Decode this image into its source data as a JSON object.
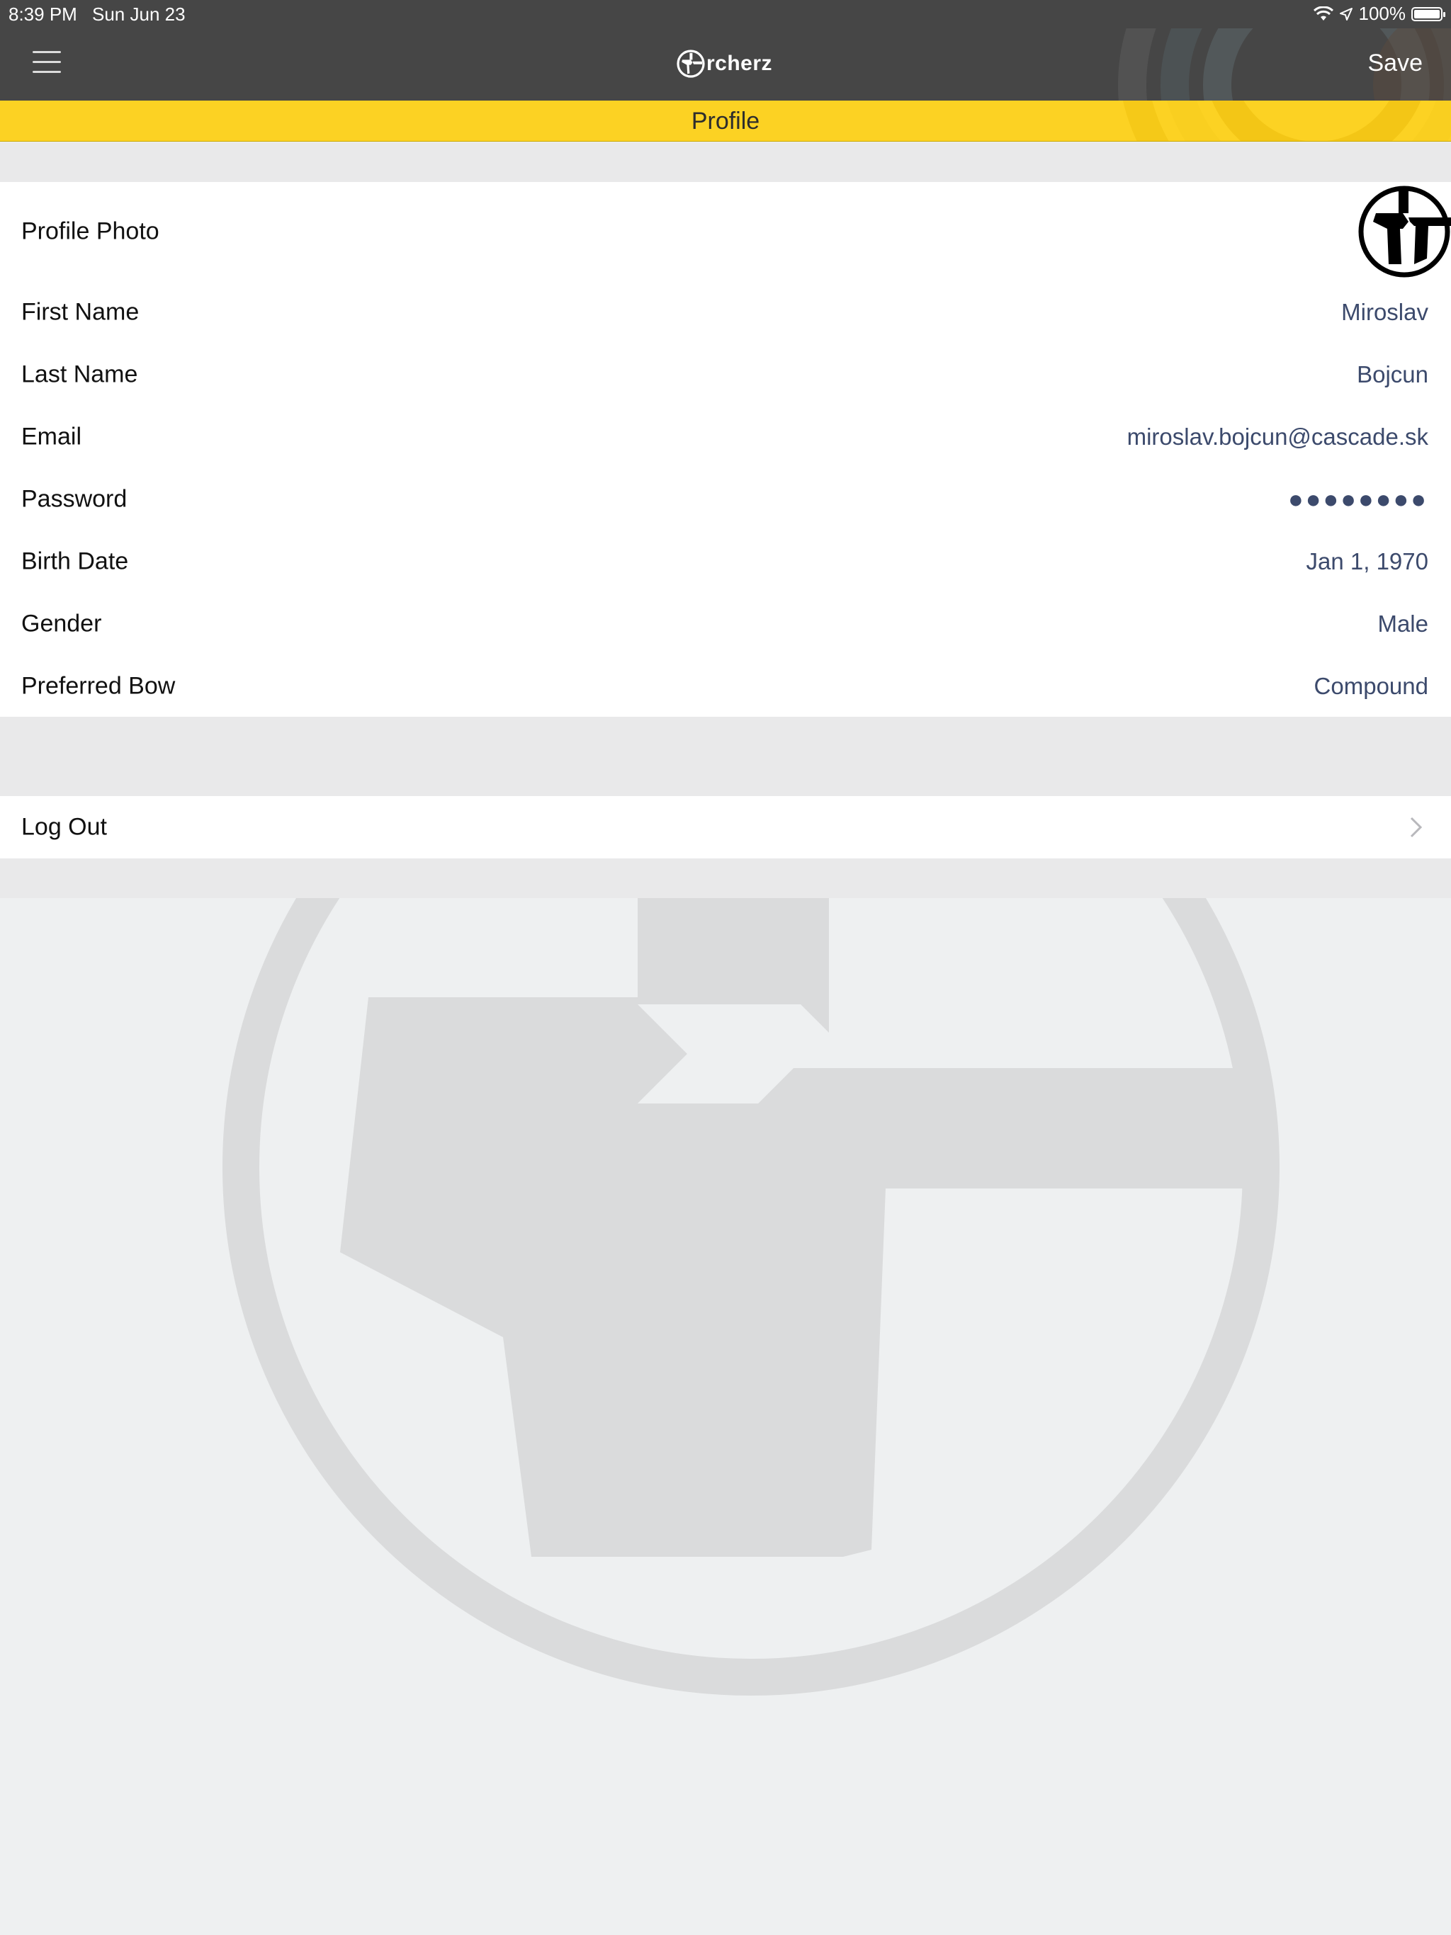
{
  "status_bar": {
    "time": "8:39 PM",
    "date": "Sun Jun 23",
    "battery": "100%",
    "battery_level": 1.0,
    "icons": [
      "wifi-icon",
      "location-icon",
      "battery-icon"
    ]
  },
  "nav": {
    "menu_icon": "hamburger-menu-icon",
    "brand_text": "rcherz",
    "save_label": "Save"
  },
  "title": "Profile",
  "profile": {
    "photo_label": "Profile Photo",
    "fields": [
      {
        "label": "First Name",
        "value": "Miroslav"
      },
      {
        "label": "Last Name",
        "value": "Bojcun"
      },
      {
        "label": "Email",
        "value": "miroslav.bojcun@cascade.sk"
      },
      {
        "label": "Password",
        "value": "●●●●●●●●"
      },
      {
        "label": "Birth Date",
        "value": "Jan 1, 1970"
      },
      {
        "label": "Gender",
        "value": "Male"
      },
      {
        "label": "Preferred Bow",
        "value": "Compound"
      }
    ]
  },
  "logout_label": "Log Out",
  "colors": {
    "nav_bg": "#464646",
    "accent_yellow": "#fcd223",
    "value_text": "#3c4a6c",
    "section_gap": "#e9e9ea",
    "background": "#eef0f1"
  }
}
